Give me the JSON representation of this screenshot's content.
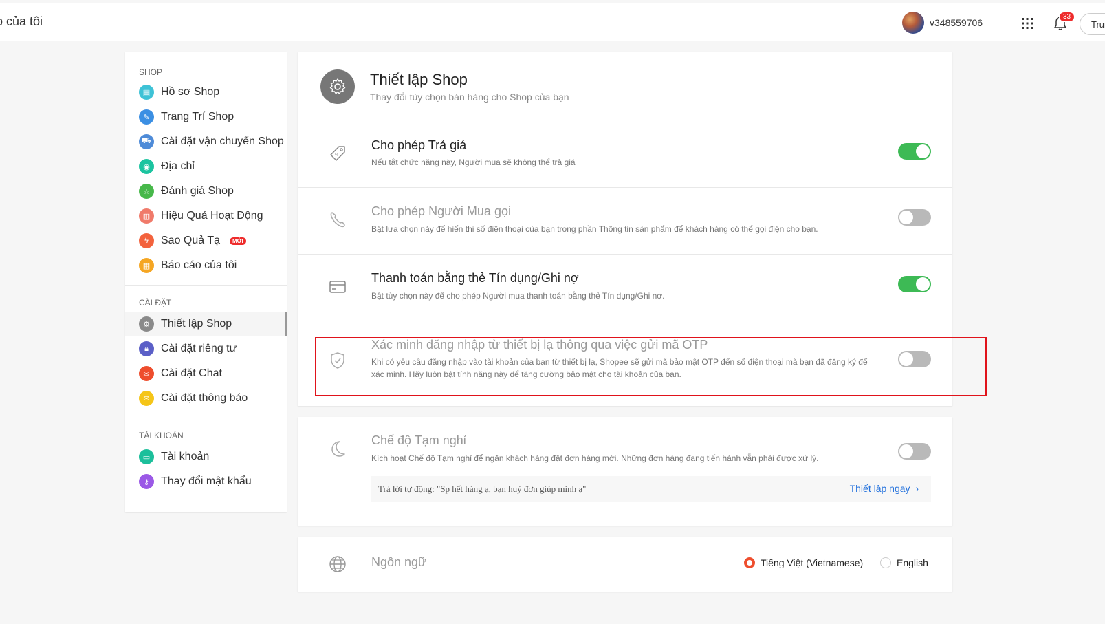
{
  "header": {
    "title": "p của tôi",
    "username": "v348559706",
    "notification_count": "33",
    "right_button": "Trung"
  },
  "sidebar": {
    "sections": [
      {
        "label": "SHOP",
        "items": [
          {
            "label": "Hồ sơ Shop",
            "icon": "profile-icon",
            "color": "#3ec2d6"
          },
          {
            "label": "Trang Trí Shop",
            "icon": "brush-icon",
            "color": "#3b8fe3"
          },
          {
            "label": "Cài đặt vận chuyển Shop",
            "icon": "truck-icon",
            "color": "#4e8bd8"
          },
          {
            "label": "Địa chỉ",
            "icon": "location-icon",
            "color": "#1cc4a0"
          },
          {
            "label": "Đánh giá Shop",
            "icon": "star-icon",
            "color": "#47b84a"
          },
          {
            "label": "Hiệu Quả Hoạt Động",
            "icon": "chart-icon",
            "color": "#f07a6a"
          },
          {
            "label": "Sao Quả Tạ",
            "icon": "bolt-icon",
            "color": "#f3623d",
            "badge": "MỚI"
          },
          {
            "label": "Báo cáo của tôi",
            "icon": "report-icon",
            "color": "#f5a623"
          }
        ]
      },
      {
        "label": "CÀI ĐẶT",
        "items": [
          {
            "label": "Thiết lập Shop",
            "icon": "gear-icon",
            "color": "#8a8a8a",
            "active": true
          },
          {
            "label": "Cài đặt riêng tư",
            "icon": "lock-icon",
            "color": "#5b5fc7"
          },
          {
            "label": "Cài đặt Chat",
            "icon": "chat-icon",
            "color": "#ee4d2d"
          },
          {
            "label": "Cài đặt thông báo",
            "icon": "mail-icon",
            "color": "#f5c518"
          }
        ]
      },
      {
        "label": "TÀI KHOẢN",
        "items": [
          {
            "label": "Tài khoản",
            "icon": "card-icon",
            "color": "#1cbf9b"
          },
          {
            "label": "Thay đổi mật khẩu",
            "icon": "key-icon",
            "color": "#9b59e6"
          }
        ]
      }
    ]
  },
  "settings": {
    "title": "Thiết lập Shop",
    "subtitle": "Thay đổi tùy chọn bán hàng cho Shop của bạn",
    "rows": [
      {
        "title": "Cho phép Trả giá",
        "desc": "Nếu tắt chức năng này, Người mua sẽ không thể trả giá",
        "on": true
      },
      {
        "title": "Cho phép Người Mua gọi",
        "desc": "Bật lựa chọn này để hiển thị số điện thoại của bạn trong phần Thông tin sản phẩm để khách hàng có thể gọi điện cho bạn.",
        "on": false
      },
      {
        "title": "Thanh toán bằng thẻ Tín dụng/Ghi nợ",
        "desc": "Bật tùy chọn này để cho phép Người mua thanh toán bằng thẻ Tín dụng/Ghi nợ.",
        "on": true
      },
      {
        "title": "Xác minh đăng nhập từ thiết bị lạ thông qua việc gửi mã OTP",
        "desc": "Khi có yêu cầu đăng nhập vào tài khoản của bạn từ thiết bị lạ, Shopee sẽ gửi mã bảo mật OTP đến số điện thoại mà bạn đã đăng ký để xác minh. Hãy luôn bật tính năng này để tăng cường bảo mật cho tài khoản của bạn.",
        "on": false
      }
    ]
  },
  "vacation": {
    "title": "Chế độ Tạm nghỉ",
    "desc": "Kích hoạt Chế độ Tạm nghỉ để ngăn khách hàng đặt đơn hàng mới. Những đơn hàng đang tiến hành vẫn phải được xử lý.",
    "on": false,
    "auto_reply": "Trả lời tự động: \"Sp hết hàng ạ, bạn huỷ đơn giúp mình ạ\"",
    "setup_link": "Thiết lập ngay"
  },
  "language": {
    "title": "Ngôn ngữ",
    "options": [
      {
        "label": "Tiếng Việt (Vietnamese)",
        "selected": true
      },
      {
        "label": "English",
        "selected": false
      }
    ]
  },
  "colors": {
    "toggle_on": "#3dba55",
    "toggle_off": "#b9b9b9",
    "highlight": "#e0131b",
    "link": "#2673dd",
    "brand": "#ee4d2d"
  }
}
